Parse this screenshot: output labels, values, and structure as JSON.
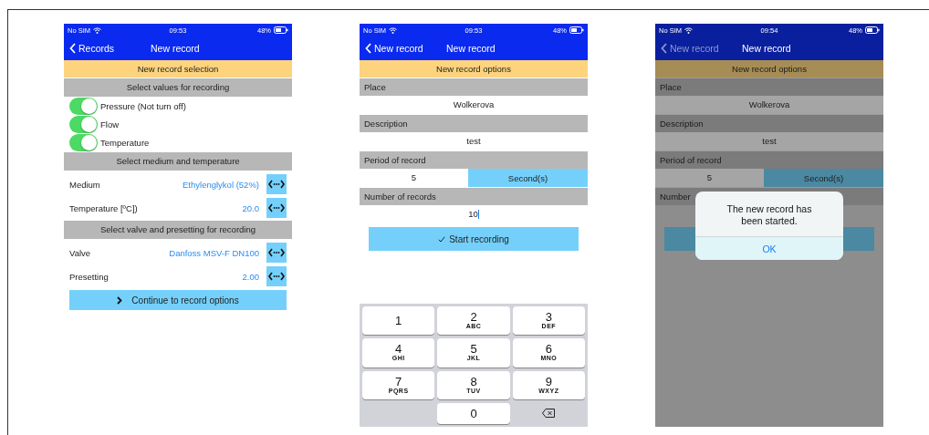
{
  "screens": [
    {
      "dimmed": false,
      "status_bar": {
        "carrier": "No SIM",
        "time": "09:53",
        "battery": "48%"
      },
      "nav": {
        "back": "Records",
        "title": "New record"
      },
      "items": [
        {
          "kind": "banner",
          "text": "New record selection"
        },
        {
          "kind": "header",
          "text": "Select values for recording"
        },
        {
          "kind": "toggle",
          "label": "Pressure (Not turn off)",
          "on": true
        },
        {
          "kind": "toggle",
          "label": "Flow",
          "on": true
        },
        {
          "kind": "toggle",
          "label": "Temperature",
          "on": true
        },
        {
          "kind": "header",
          "text": "Select medium and temperature"
        },
        {
          "kind": "picker",
          "label": "Medium",
          "value": "Ethylenglykol (52%)"
        },
        {
          "kind": "picker",
          "label": "Temperature [ºC])",
          "value": "20.0"
        },
        {
          "kind": "header",
          "text": "Select valve and presetting for recording"
        },
        {
          "kind": "picker",
          "label": "Valve",
          "value": "Danfoss MSV-F  DN100"
        },
        {
          "kind": "picker",
          "label": "Presetting",
          "value": "2.00"
        },
        {
          "kind": "next_button",
          "label": "Continue to record options"
        }
      ]
    },
    {
      "dimmed": false,
      "status_bar": {
        "carrier": "No SIM",
        "time": "09:53",
        "battery": "48%"
      },
      "nav": {
        "back": "New record",
        "title": "New record"
      },
      "items": [
        {
          "kind": "banner",
          "text": "New record options"
        },
        {
          "kind": "label",
          "text": "Place"
        },
        {
          "kind": "value",
          "text": "Wolkerova",
          "focused": false
        },
        {
          "kind": "label",
          "text": "Description"
        },
        {
          "kind": "value",
          "text": "test",
          "focused": false
        },
        {
          "kind": "label",
          "text": "Period of record"
        },
        {
          "kind": "split",
          "value": "5",
          "unit": "Second(s)"
        },
        {
          "kind": "label",
          "text": "Number of records"
        },
        {
          "kind": "value",
          "text": "10",
          "focused": true
        },
        {
          "kind": "confirm_button",
          "label": "Start recording"
        }
      ],
      "keypad": [
        {
          "kind": "digit",
          "digit": "1"
        },
        {
          "kind": "digit",
          "digit": "2",
          "letters": "ABC"
        },
        {
          "kind": "digit",
          "digit": "3",
          "letters": "DEF"
        },
        {
          "kind": "digit",
          "digit": "4",
          "letters": "GHI"
        },
        {
          "kind": "digit",
          "digit": "5",
          "letters": "JKL"
        },
        {
          "kind": "digit",
          "digit": "6",
          "letters": "MNO"
        },
        {
          "kind": "digit",
          "digit": "7",
          "letters": "PQRS"
        },
        {
          "kind": "digit",
          "digit": "8",
          "letters": "TUV"
        },
        {
          "kind": "digit",
          "digit": "9",
          "letters": "WXYZ"
        },
        {
          "kind": "blank"
        },
        {
          "kind": "digit",
          "digit": "0"
        },
        {
          "kind": "delete"
        }
      ]
    },
    {
      "dimmed": true,
      "status_bar": {
        "carrier": "No SIM",
        "time": "09:54",
        "battery": "48%"
      },
      "nav": {
        "back": "New record",
        "title": "New record"
      },
      "items": [
        {
          "kind": "banner",
          "text": "New record options"
        },
        {
          "kind": "label",
          "text": "Place"
        },
        {
          "kind": "value",
          "text": "Wolkerova",
          "focused": false
        },
        {
          "kind": "label",
          "text": "Description"
        },
        {
          "kind": "value",
          "text": "test",
          "focused": false
        },
        {
          "kind": "label",
          "text": "Period of record"
        },
        {
          "kind": "split",
          "value": "5",
          "unit": "Second(s)"
        },
        {
          "kind": "label",
          "text": "Number"
        },
        {
          "kind": "spacer"
        },
        {
          "kind": "covered_button"
        }
      ],
      "alert": {
        "message": "The new record has been started.",
        "button": "OK"
      }
    }
  ]
}
